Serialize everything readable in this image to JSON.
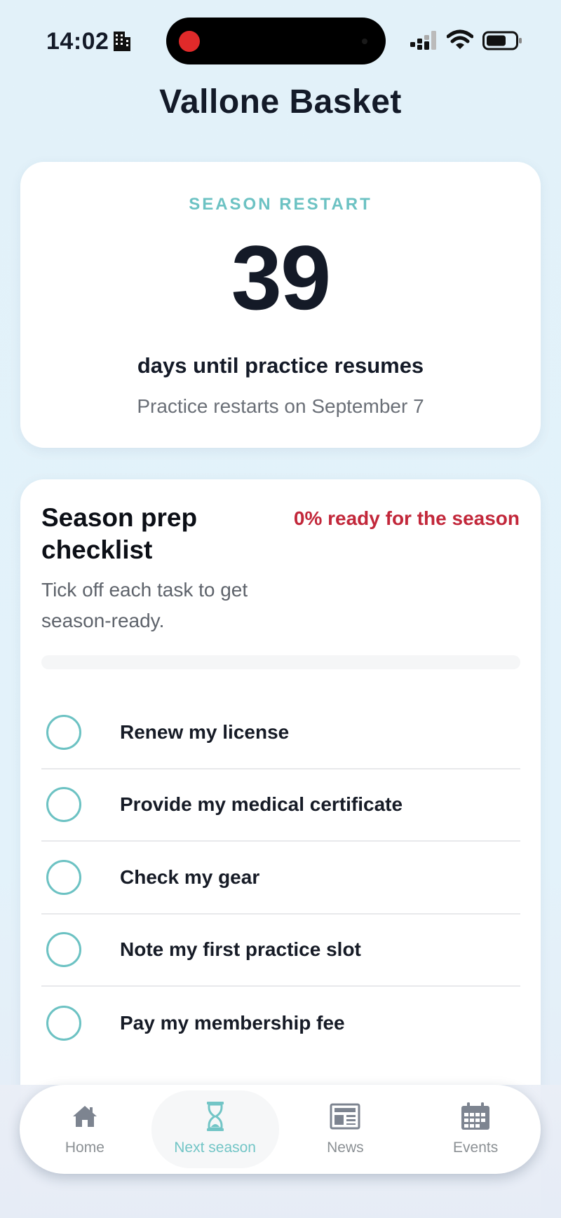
{
  "status_bar": {
    "time": "14:02",
    "icons": [
      "building-icon",
      "signal-icon",
      "wifi-icon",
      "battery-icon"
    ]
  },
  "app": {
    "title": "Vallone Basket"
  },
  "countdown": {
    "label": "SEASON RESTART",
    "days": "39",
    "caption": "days until practice resumes",
    "restart_note": "Practice restarts on September 7"
  },
  "checklist": {
    "title": "Season prep checklist",
    "subtitle": "Tick off each task to get season-ready.",
    "ready_status": "0% ready for the season",
    "progress_fraction": 0,
    "tasks": [
      {
        "label": "Renew my license",
        "done": false
      },
      {
        "label": "Provide my medical certificate",
        "done": false
      },
      {
        "label": "Check my gear",
        "done": false
      },
      {
        "label": "Note my first practice slot",
        "done": false
      },
      {
        "label": "Pay my membership fee",
        "done": false
      }
    ]
  },
  "tabs": [
    {
      "label": "Home",
      "icon": "house-icon",
      "active": false
    },
    {
      "label": "Next season",
      "icon": "hourglass-icon",
      "active": true
    },
    {
      "label": "News",
      "icon": "newspaper-icon",
      "active": false
    },
    {
      "label": "Events",
      "icon": "calendar-icon",
      "active": false
    }
  ],
  "colors": {
    "accent": "#6cc2c3",
    "alert": "#c2273a",
    "background": "#e2f1f9",
    "text": "#131a28"
  }
}
